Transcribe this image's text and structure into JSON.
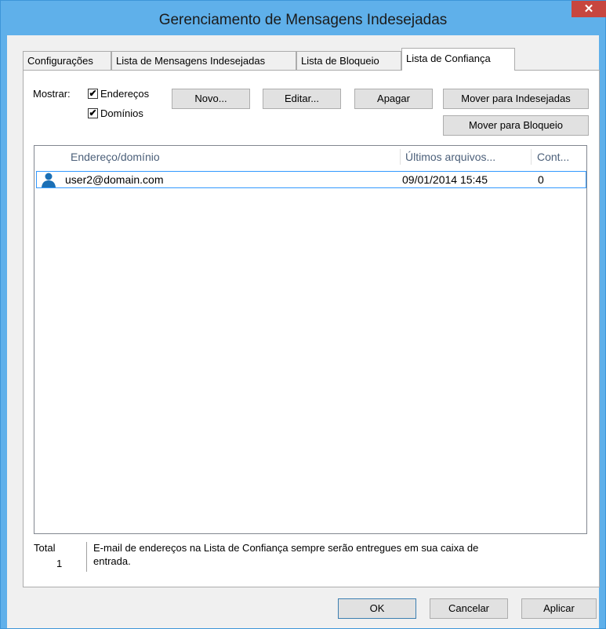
{
  "window": {
    "title": "Gerenciamento de Mensagens Indesejadas",
    "close_glyph": "✕"
  },
  "tabs": [
    {
      "label": "Configurações",
      "active": false
    },
    {
      "label": "Lista de Mensagens Indesejadas",
      "active": false
    },
    {
      "label": "Lista de Bloqueio",
      "active": false
    },
    {
      "label": "Lista de Confiança",
      "active": true
    }
  ],
  "filters": {
    "label": "Mostrar:",
    "enderecos": {
      "label": "Endereços",
      "checked": true,
      "glyph": "✔"
    },
    "dominios": {
      "label": "Domínios",
      "checked": true,
      "glyph": "✔"
    }
  },
  "buttons": {
    "novo": "Novo...",
    "editar": "Editar...",
    "apagar": "Apagar",
    "mover_indesejadas": "Mover para Indesejadas",
    "mover_bloqueio": "Mover para Bloqueio"
  },
  "list": {
    "columns": [
      "Endereço/domínio",
      "Últimos arquivos...",
      "Cont..."
    ],
    "rows": [
      {
        "icon": "contact-person-icon",
        "address": "user2@domain.com",
        "last_files": "09/01/2014 15:45",
        "count": "0"
      }
    ]
  },
  "footer": {
    "total_label": "Total",
    "total_value": "1",
    "note_line1": "E-mail de endereços na Lista de Confiança sempre serão entregues em sua caixa de",
    "note_line2": "entrada."
  },
  "dialog_buttons": {
    "ok": "OK",
    "cancel": "Cancelar",
    "apply": "Aplicar"
  },
  "colors": {
    "titlebar": "#5fb0ea",
    "close": "#c7463f",
    "selection_border": "#3399ff",
    "icon": "#1a6fb5"
  }
}
